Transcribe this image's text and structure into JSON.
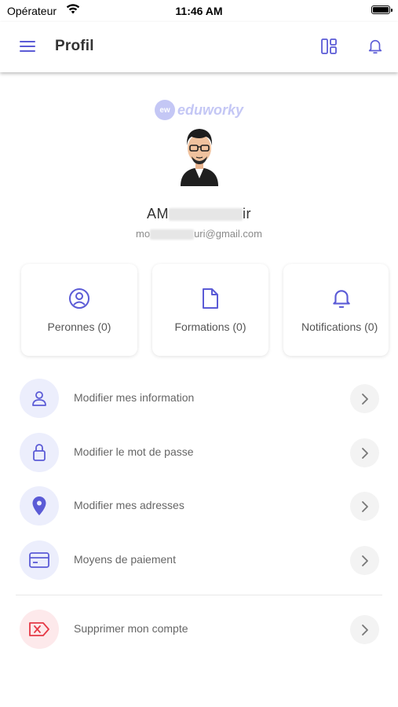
{
  "status_bar": {
    "carrier": "Opérateur",
    "time": "11:46 AM"
  },
  "header": {
    "title": "Profil"
  },
  "brand": {
    "logo_mark": "ew",
    "logo_word": "eduworky"
  },
  "profile": {
    "name_start": "AM",
    "name_end": "ir",
    "email_start": "mo",
    "email_end": "uri@gmail.com"
  },
  "stats": [
    {
      "label": "Peronnes (0)",
      "icon": "user-circle-icon"
    },
    {
      "label": "Formations (0)",
      "icon": "document-icon"
    },
    {
      "label": "Notifications (0)",
      "icon": "bell-icon"
    }
  ],
  "menu": [
    {
      "label": "Modifier mes information",
      "icon": "user-icon"
    },
    {
      "label": "Modifier le mot de passe",
      "icon": "lock-icon"
    },
    {
      "label": "Modifier mes adresses",
      "icon": "location-pin-icon"
    },
    {
      "label": "Moyens de paiement",
      "icon": "credit-card-icon"
    },
    {
      "label": "Supprimer mon compte",
      "icon": "delete-tag-icon"
    }
  ],
  "colors": {
    "accent": "#5b5bd6",
    "danger": "#e53946",
    "icon_bg": "#eceefc",
    "danger_bg": "#fde9eb"
  }
}
